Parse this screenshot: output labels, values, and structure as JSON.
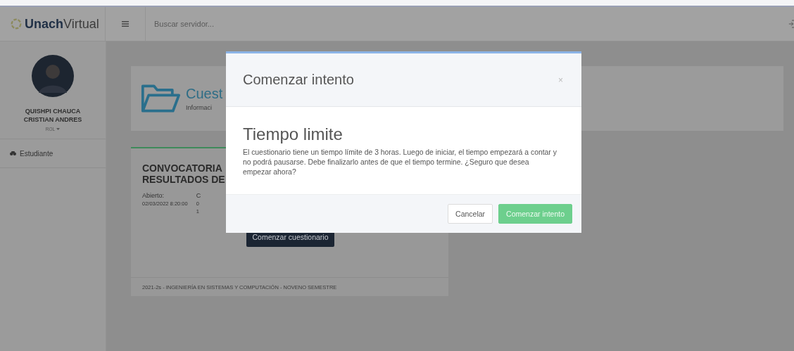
{
  "brand": {
    "name_bold": "Unach",
    "name_light": "Virtual"
  },
  "topbar": {
    "search": {
      "placeholder": "Buscar servidor..."
    }
  },
  "sidebar": {
    "user": {
      "name": "QUISHPI CHAUCA CRISTIAN ANDRES",
      "role": "ROL"
    },
    "items": [
      {
        "label": "Estudiante"
      }
    ]
  },
  "page_header": {
    "title": "Cuest",
    "subtitle": "Informaci"
  },
  "quiz_card": {
    "title_lines": [
      "CONVOCATORIA",
      "RESULTADOS DE"
    ],
    "opened_label": "Abierto:",
    "opened_date": "02/03/2022 8:20:00",
    "column_2": [
      "C",
      "0",
      "1"
    ],
    "start_button": "Comenzar cuestionario",
    "footer": "2021-2s - INGENIERÍA EN SISTEMAS Y COMPUTACIÓN - NOVENO SEMESTRE"
  },
  "modal": {
    "title": "Comenzar intento",
    "close": "×",
    "heading": "Tiempo limite",
    "body": "El cuestionario tiene un tiempo límite de 3 horas. Luego de iniciar, el tiempo empezará a contar y no podrá pausarse. Debe finalizarlo antes de que el tiempo termine. ¿Seguro que desea empezar ahora?",
    "buttons": [
      {
        "label": "Cancelar",
        "kind": "secondary"
      },
      {
        "label": "Comenzar intento",
        "kind": "primary"
      }
    ]
  }
}
